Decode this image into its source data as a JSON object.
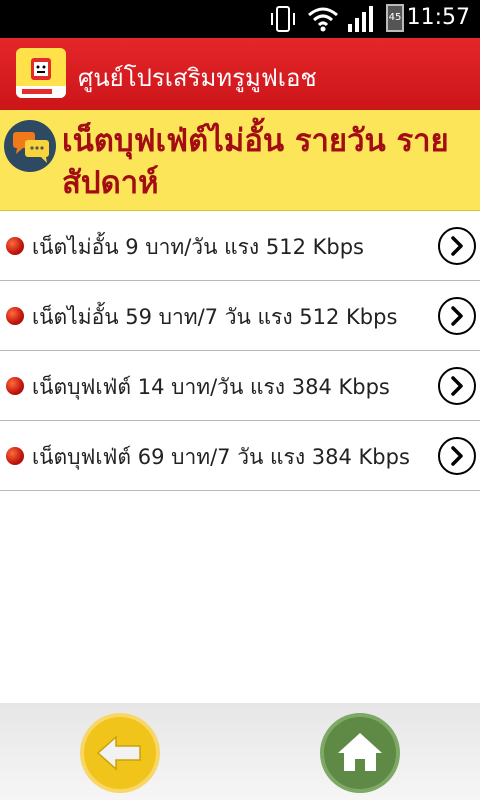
{
  "status_bar": {
    "time": "11:57",
    "battery_level": "45",
    "icons": [
      "vibrate-icon",
      "wifi-icon",
      "signal-icon",
      "battery-icon"
    ]
  },
  "action_bar": {
    "title": "ศูนย์โปรเสริมทรูมูฟเอช",
    "app_icon": "truemove-h-app-icon"
  },
  "header": {
    "title": "เน็ตบุฟเฟ่ต์ไม่อั้น รายวัน รายสัปดาห์",
    "icon": "chat-bubbles-icon"
  },
  "list": {
    "items": [
      {
        "label": "เน็ตไม่อั้น 9 บาท/วัน แรง 512 Kbps"
      },
      {
        "label": "เน็ตไม่อั้น 59 บาท/7 วัน แรง 512 Kbps"
      },
      {
        "label": "เน็ตบุฟเฟ่ต์ 14 บาท/วัน แรง 384 Kbps"
      },
      {
        "label": "เน็ตบุฟเฟ่ต์ 69 บาท/7 วัน แรง 384 Kbps"
      }
    ]
  },
  "bottom_bar": {
    "back_icon": "arrow-left-icon",
    "home_icon": "home-icon"
  },
  "colors": {
    "action_bar": "#d81c20",
    "header_bg": "#fde55a",
    "header_text": "#a10d12",
    "back_button": "#f1c41b",
    "home_button": "#5e8a46"
  }
}
